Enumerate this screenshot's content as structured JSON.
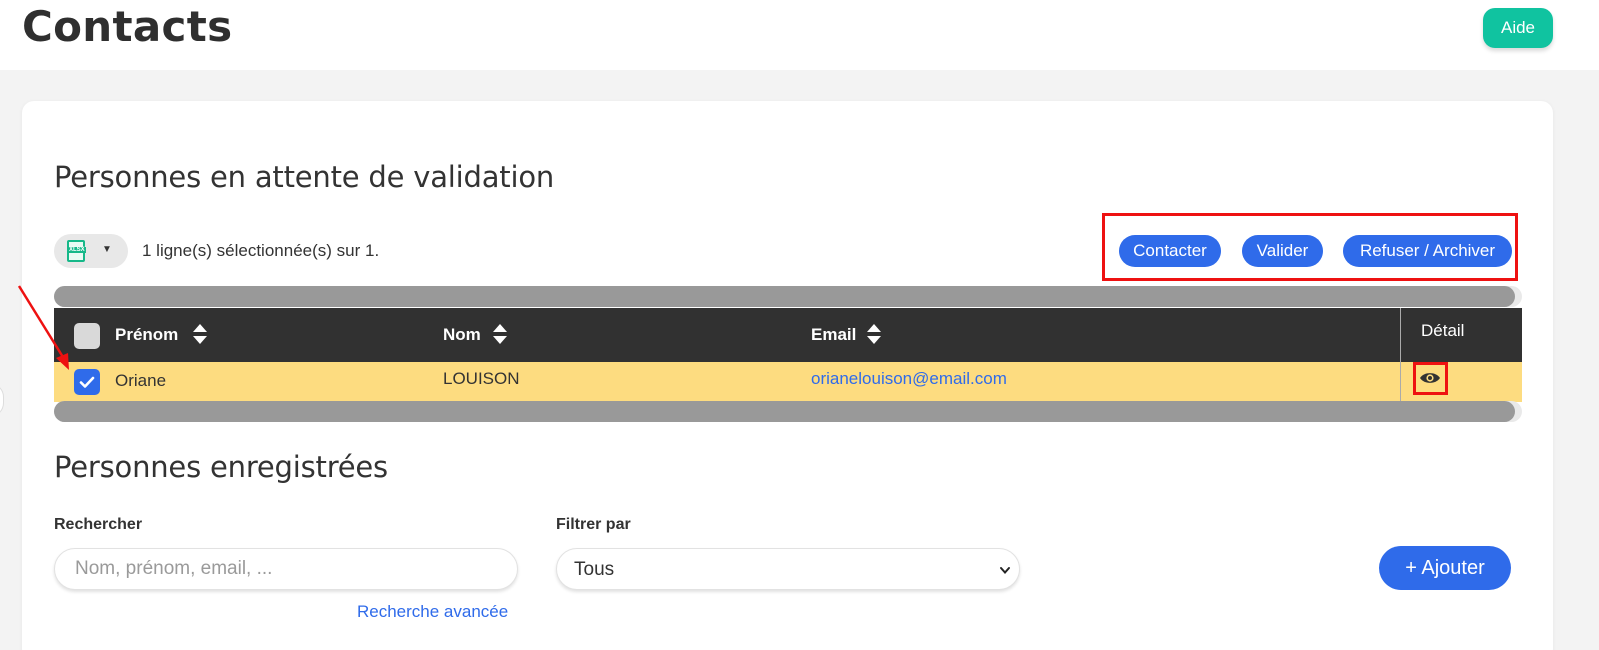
{
  "header": {
    "title": "Contacts",
    "help_label": "Aide",
    "help_color": "#10c3a0"
  },
  "pending": {
    "title": "Personnes en attente de validation",
    "export_icon": "xlsx-file-icon",
    "export_icon_text": "XLSX",
    "selection_text": "1 ligne(s) sélectionnée(s) sur 1.",
    "actions": {
      "contact_label": "Contacter",
      "validate_label": "Valider",
      "reject_label": "Refuser / Archiver"
    },
    "columns": {
      "first_name": "Prénom",
      "last_name": "Nom",
      "email": "Email",
      "detail": "Détail"
    },
    "rows": [
      {
        "selected": true,
        "first_name": "Oriane",
        "last_name": "LOUISON",
        "email": "orianelouison@email.com",
        "detail_icon": "eye-icon"
      }
    ],
    "row_highlight_color": "#fddc80",
    "annotation_color": "#ee1111"
  },
  "registered": {
    "title": "Personnes enregistrées",
    "search_label": "Rechercher",
    "search_placeholder": "Nom, prénom, email, ...",
    "search_value": "",
    "filter_label": "Filtrer par",
    "filter_value": "Tous",
    "advanced_search_label": "Recherche avancée",
    "add_label": "+ Ajouter"
  },
  "accent_color": "#2f6bea"
}
